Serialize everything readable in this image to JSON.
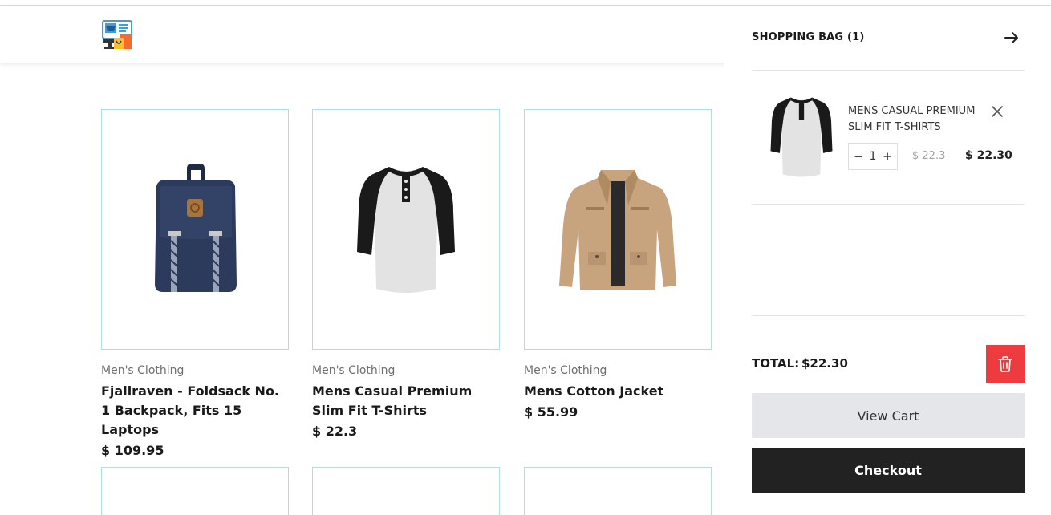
{
  "products": [
    {
      "category": "Men's Clothing",
      "name": "Fjallraven - Foldsack No. 1 Backpack, Fits 15 Laptops",
      "price": "$ 109.95"
    },
    {
      "category": "Men's Clothing",
      "name": "Mens Casual Premium Slim Fit T-Shirts",
      "price": "$ 22.3"
    },
    {
      "category": "Men's Clothing",
      "name": "Mens Cotton Jacket",
      "price": "$ 55.99"
    }
  ],
  "drawer": {
    "title": "SHOPPING BAG (1)",
    "item": {
      "name": "Mens Casual Premium Slim Fit T-Shirts",
      "quantity": "1",
      "unit_price": "$ 22.3",
      "line_total": "$ 22.30"
    },
    "total_label": "TOTAL:",
    "total_value": "$22.30",
    "view_cart_label": "View Cart",
    "checkout_label": "Checkout"
  },
  "colors": {
    "card_border": "#a9e2e6",
    "trash_button": "#ee3b3f",
    "checkout_button": "#222222",
    "view_cart_button": "#e5e6e9"
  }
}
